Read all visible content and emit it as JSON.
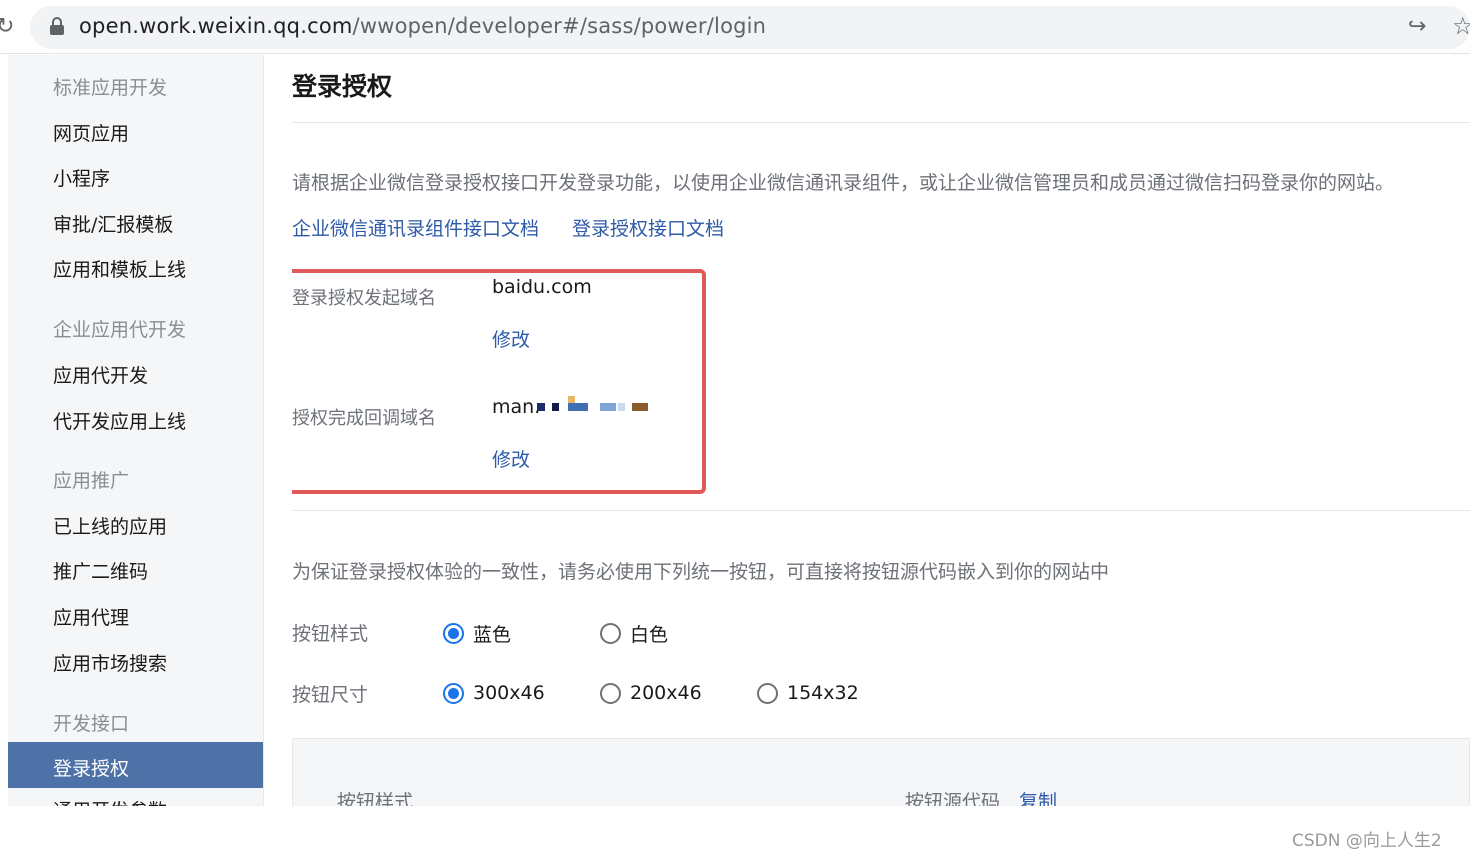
{
  "browser": {
    "url_host": "open.work.weixin.qq.com",
    "url_path": "/wwopen/developer#/sass/power/login"
  },
  "sidebar": {
    "groups": [
      {
        "title": "标准应用开发",
        "items": [
          "网页应用",
          "小程序",
          "审批/汇报模板",
          "应用和模板上线"
        ]
      },
      {
        "title": "企业应用代开发",
        "items": [
          "应用代开发",
          "代开发应用上线"
        ]
      },
      {
        "title": "应用推广",
        "items": [
          "已上线的应用",
          "推广二维码",
          "应用代理",
          "应用市场搜索"
        ]
      },
      {
        "title": "开发接口",
        "items": [
          "登录授权",
          "通用开发参数"
        ]
      }
    ],
    "active_item": "登录授权"
  },
  "main": {
    "title": "登录授权",
    "description": "请根据企业微信登录授权接口开发登录功能，以使用企业微信通讯录组件，或让企业微信管理员和成员通过微信扫码登录你的网站。",
    "links": [
      "企业微信通讯录组件接口文档",
      "登录授权接口文档"
    ],
    "fields": [
      {
        "label": "登录授权发起域名",
        "value": "baidu.com",
        "action": "修改"
      },
      {
        "label": "授权完成回调域名",
        "value": "man.",
        "action": "修改"
      }
    ],
    "button_section": {
      "description": "为保证登录授权体验的一致性，请务必使用下列统一按钮，可直接将按钮源代码嵌入到你的网站中",
      "style_label": "按钮样式",
      "style_options": [
        {
          "label": "蓝色",
          "checked": true
        },
        {
          "label": "白色",
          "checked": false
        }
      ],
      "size_label": "按钮尺寸",
      "size_options": [
        {
          "label": "300x46",
          "checked": true
        },
        {
          "label": "200x46",
          "checked": false
        },
        {
          "label": "154x32",
          "checked": false
        }
      ],
      "preview_header_style": "按钮样式",
      "preview_header_code": "按钮源代码",
      "copy_label": "复制"
    }
  },
  "watermark": "CSDN @向上人生2",
  "colors": {
    "sidebar_active_bg": "#4e72a8",
    "link": "#2e5aa8",
    "highlight_border": "#e05a5a",
    "radio_checked": "#1a73e8"
  }
}
